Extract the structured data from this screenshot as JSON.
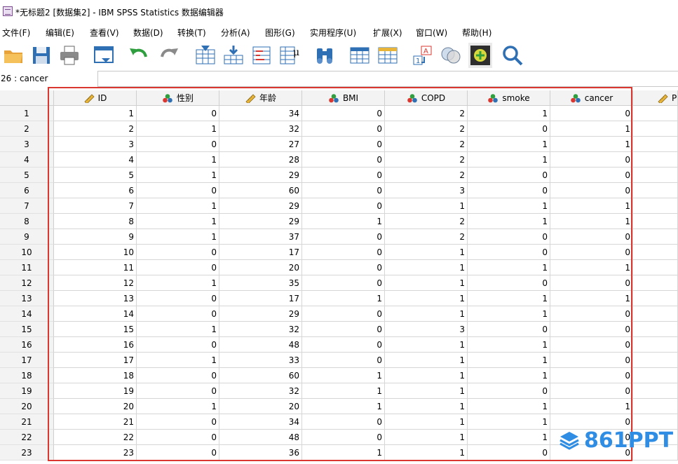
{
  "window": {
    "title": "*无标题2 [数据集2] - IBM SPSS Statistics 数据编辑器"
  },
  "menu": [
    "文件(F)",
    "编辑(E)",
    "查看(V)",
    "数据(D)",
    "转换(T)",
    "分析(A)",
    "图形(G)",
    "实用程序(U)",
    "扩展(X)",
    "窗口(W)",
    "帮助(H)"
  ],
  "toolbar": [
    {
      "name": "open-folder-icon"
    },
    {
      "name": "save-icon"
    },
    {
      "name": "print-icon"
    },
    {
      "name": "recall-dialog-icon"
    },
    {
      "name": "undo-icon"
    },
    {
      "name": "redo-icon"
    },
    {
      "name": "goto-case-icon"
    },
    {
      "name": "goto-variable-icon"
    },
    {
      "name": "variables-icon"
    },
    {
      "name": "run-descriptives-icon"
    },
    {
      "name": "find-icon"
    },
    {
      "name": "insert-cases-icon"
    },
    {
      "name": "insert-variable-icon"
    },
    {
      "name": "split-file-icon"
    },
    {
      "name": "weight-cases-icon"
    },
    {
      "name": "select-cases-icon"
    },
    {
      "name": "value-labels-icon"
    },
    {
      "name": "search-icon"
    }
  ],
  "varbar": {
    "location": "26 : cancer",
    "value": ""
  },
  "columns": [
    {
      "label": "ID",
      "icon": "ruler-icon"
    },
    {
      "label": "性别",
      "icon": "nominal-icon"
    },
    {
      "label": "年龄",
      "icon": "ruler-icon"
    },
    {
      "label": "BMI",
      "icon": "nominal-icon"
    },
    {
      "label": "COPD",
      "icon": "nominal-icon"
    },
    {
      "label": "smoke",
      "icon": "nominal-icon"
    },
    {
      "label": "cancer",
      "icon": "nominal-icon"
    },
    {
      "label": "PI",
      "icon": "ruler-icon"
    }
  ],
  "rows": [
    {
      "n": "1",
      "cells": [
        "1",
        "0",
        "34",
        "0",
        "2",
        "1",
        "0"
      ]
    },
    {
      "n": "2",
      "cells": [
        "2",
        "1",
        "32",
        "0",
        "2",
        "0",
        "1"
      ]
    },
    {
      "n": "3",
      "cells": [
        "3",
        "0",
        "27",
        "0",
        "2",
        "1",
        "1"
      ]
    },
    {
      "n": "4",
      "cells": [
        "4",
        "1",
        "28",
        "0",
        "2",
        "1",
        "0"
      ]
    },
    {
      "n": "5",
      "cells": [
        "5",
        "1",
        "29",
        "0",
        "2",
        "0",
        "0"
      ]
    },
    {
      "n": "6",
      "cells": [
        "6",
        "0",
        "60",
        "0",
        "3",
        "0",
        "0"
      ]
    },
    {
      "n": "7",
      "cells": [
        "7",
        "1",
        "29",
        "0",
        "1",
        "1",
        "1"
      ]
    },
    {
      "n": "8",
      "cells": [
        "8",
        "1",
        "29",
        "1",
        "2",
        "1",
        "1"
      ]
    },
    {
      "n": "9",
      "cells": [
        "9",
        "1",
        "37",
        "0",
        "2",
        "0",
        "0"
      ]
    },
    {
      "n": "10",
      "cells": [
        "10",
        "0",
        "17",
        "0",
        "1",
        "0",
        "0"
      ]
    },
    {
      "n": "11",
      "cells": [
        "11",
        "0",
        "20",
        "0",
        "1",
        "1",
        "1"
      ]
    },
    {
      "n": "12",
      "cells": [
        "12",
        "1",
        "35",
        "0",
        "1",
        "0",
        "0"
      ]
    },
    {
      "n": "13",
      "cells": [
        "13",
        "0",
        "17",
        "1",
        "1",
        "1",
        "1"
      ]
    },
    {
      "n": "14",
      "cells": [
        "14",
        "0",
        "29",
        "0",
        "1",
        "1",
        "0"
      ]
    },
    {
      "n": "15",
      "cells": [
        "15",
        "1",
        "32",
        "0",
        "3",
        "0",
        "0"
      ]
    },
    {
      "n": "16",
      "cells": [
        "16",
        "0",
        "48",
        "0",
        "1",
        "1",
        "0"
      ]
    },
    {
      "n": "17",
      "cells": [
        "17",
        "1",
        "33",
        "0",
        "1",
        "1",
        "0"
      ]
    },
    {
      "n": "18",
      "cells": [
        "18",
        "0",
        "60",
        "1",
        "1",
        "1",
        "0"
      ]
    },
    {
      "n": "19",
      "cells": [
        "19",
        "0",
        "32",
        "1",
        "1",
        "0",
        "0"
      ]
    },
    {
      "n": "20",
      "cells": [
        "20",
        "1",
        "20",
        "1",
        "1",
        "1",
        "1"
      ]
    },
    {
      "n": "21",
      "cells": [
        "21",
        "0",
        "34",
        "0",
        "1",
        "1",
        "0"
      ]
    },
    {
      "n": "22",
      "cells": [
        "22",
        "0",
        "48",
        "0",
        "1",
        "1",
        "0"
      ]
    },
    {
      "n": "23",
      "cells": [
        "23",
        "0",
        "36",
        "1",
        "1",
        "0",
        "0"
      ]
    }
  ],
  "watermark": "861PPT",
  "colors": {
    "highlight_box": "#d9372f",
    "watermark": "#2f8de4"
  }
}
